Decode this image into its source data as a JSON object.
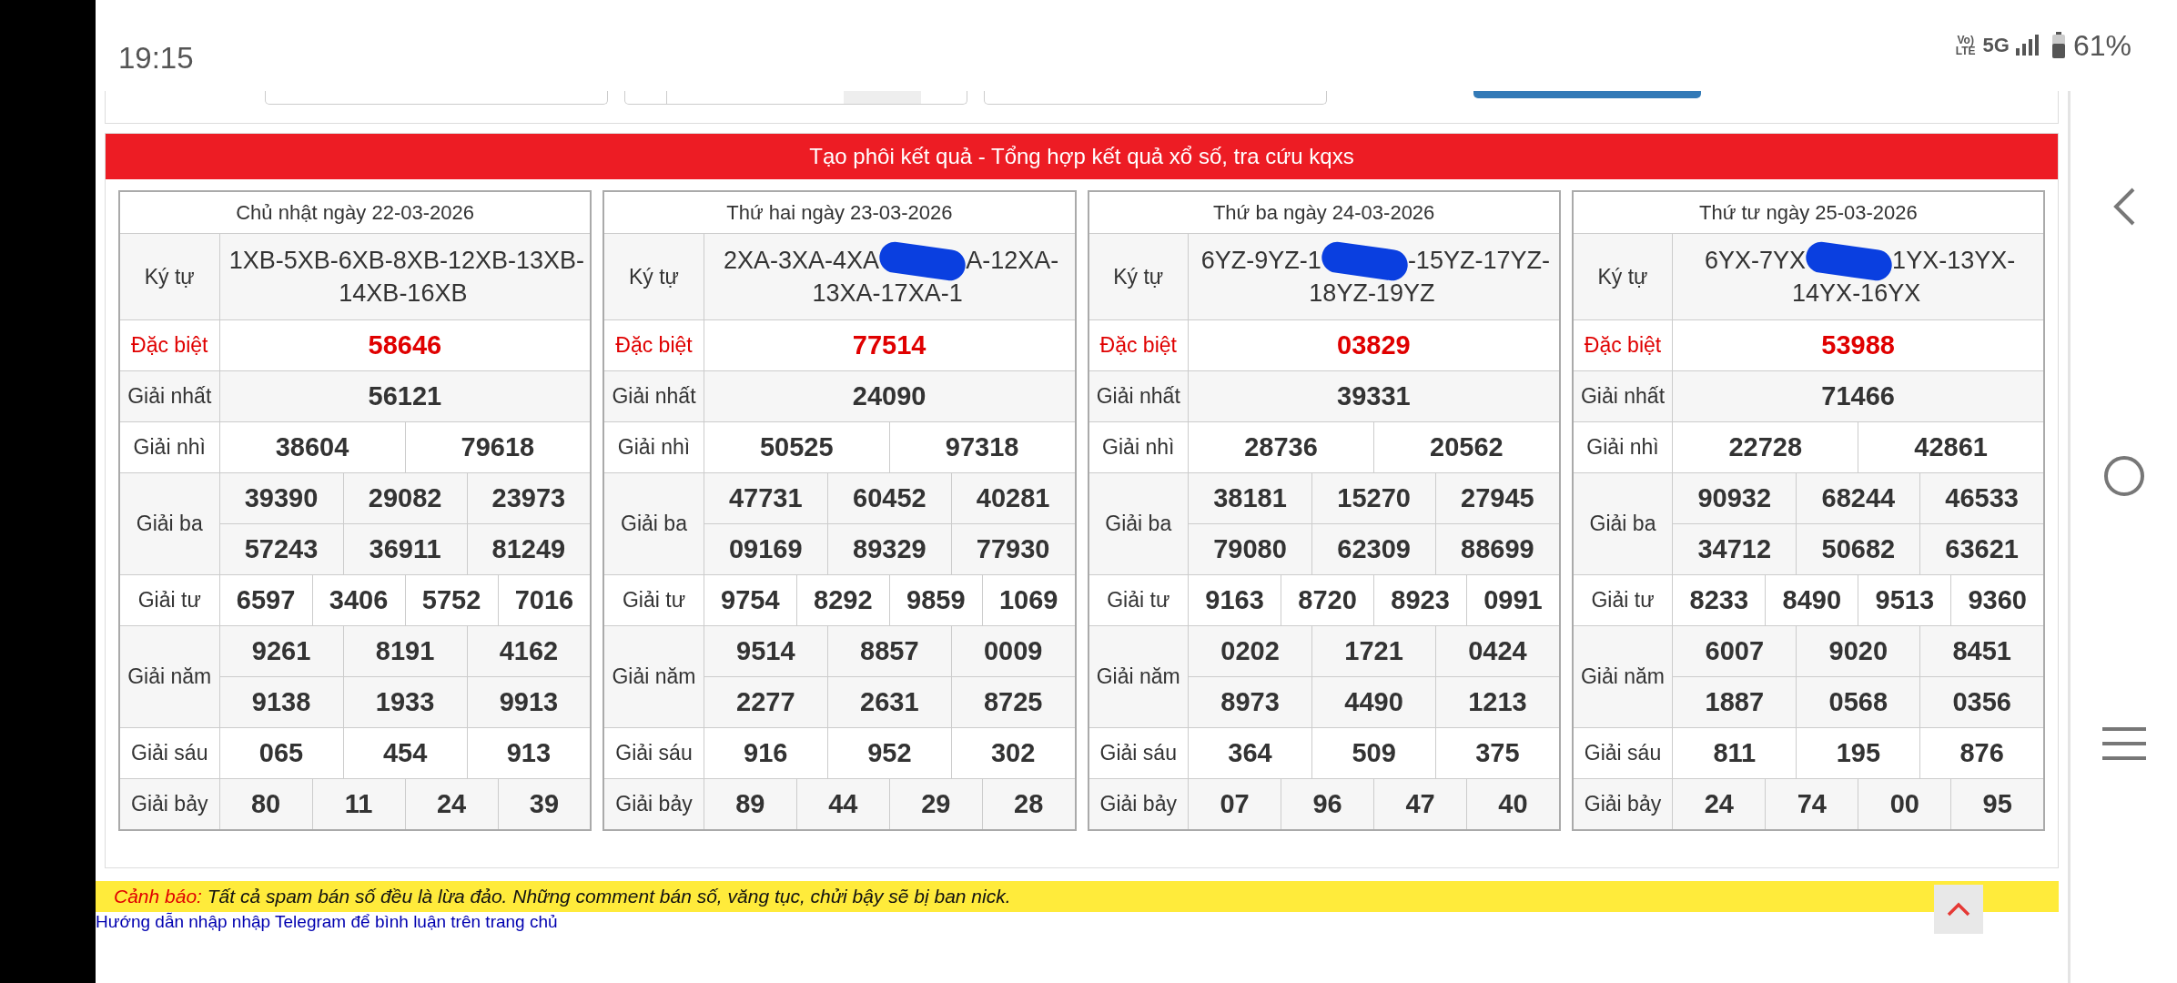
{
  "status_bar": {
    "time": "19:15",
    "volte": [
      "Vo)",
      "LTE"
    ],
    "network": "5G",
    "battery": "61%"
  },
  "banner": "Tạo phôi kết quả - Tổng hợp kết quả xổ số, tra cứu kqxs",
  "results": [
    {
      "date": "Chủ nhật ngày 22-03-2026",
      "ky_tu_label": "Ký tự",
      "ky_tu": [
        "1XB-5XB-6XB-8XB-12XB-13XB-14XB-16XB"
      ],
      "prizes": [
        {
          "label": "Đặc biệt",
          "kind": "special",
          "rows": [
            [
              "58646"
            ]
          ]
        },
        {
          "label": "Giải nhất",
          "kind": "normal",
          "rows": [
            [
              "56121"
            ]
          ]
        },
        {
          "label": "Giải nhì",
          "kind": "normal",
          "rows": [
            [
              "38604",
              "79618"
            ]
          ]
        },
        {
          "label": "Giải ba",
          "kind": "normal",
          "rows": [
            [
              "39390",
              "29082",
              "23973"
            ],
            [
              "57243",
              "36911",
              "81249"
            ]
          ]
        },
        {
          "label": "Giải tư",
          "kind": "normal",
          "rows": [
            [
              "6597",
              "3406",
              "5752",
              "7016"
            ]
          ]
        },
        {
          "label": "Giải năm",
          "kind": "normal",
          "rows": [
            [
              "9261",
              "8191",
              "4162"
            ],
            [
              "9138",
              "1933",
              "9913"
            ]
          ]
        },
        {
          "label": "Giải sáu",
          "kind": "normal",
          "rows": [
            [
              "065",
              "454",
              "913"
            ]
          ]
        },
        {
          "label": "Giải bảy",
          "kind": "normal",
          "rows": [
            [
              "80",
              "11",
              "24",
              "39"
            ]
          ]
        }
      ]
    },
    {
      "date": "Thứ hai ngày 23-03-2026",
      "ky_tu_label": "Ký tự",
      "ky_tu": [
        "2XA-3XA-4XA",
        "A-12XA-13XA-17XA-1"
      ],
      "prizes": [
        {
          "label": "Đặc biệt",
          "kind": "special",
          "rows": [
            [
              "77514"
            ]
          ]
        },
        {
          "label": "Giải nhất",
          "kind": "normal",
          "rows": [
            [
              "24090"
            ]
          ]
        },
        {
          "label": "Giải nhì",
          "kind": "normal",
          "rows": [
            [
              "50525",
              "97318"
            ]
          ]
        },
        {
          "label": "Giải ba",
          "kind": "normal",
          "rows": [
            [
              "47731",
              "60452",
              "40281"
            ],
            [
              "09169",
              "89329",
              "77930"
            ]
          ]
        },
        {
          "label": "Giải tư",
          "kind": "normal",
          "rows": [
            [
              "9754",
              "8292",
              "9859",
              "1069"
            ]
          ]
        },
        {
          "label": "Giải năm",
          "kind": "normal",
          "rows": [
            [
              "9514",
              "8857",
              "0009"
            ],
            [
              "2277",
              "2631",
              "8725"
            ]
          ]
        },
        {
          "label": "Giải sáu",
          "kind": "normal",
          "rows": [
            [
              "916",
              "952",
              "302"
            ]
          ]
        },
        {
          "label": "Giải bảy",
          "kind": "normal",
          "rows": [
            [
              "89",
              "44",
              "29",
              "28"
            ]
          ]
        }
      ]
    },
    {
      "date": "Thứ ba ngày 24-03-2026",
      "ky_tu_label": "Ký tự",
      "ky_tu": [
        "6YZ-9YZ-1",
        "-15YZ-17YZ-18YZ-19YZ"
      ],
      "prizes": [
        {
          "label": "Đặc biệt",
          "kind": "special",
          "rows": [
            [
              "03829"
            ]
          ]
        },
        {
          "label": "Giải nhất",
          "kind": "normal",
          "rows": [
            [
              "39331"
            ]
          ]
        },
        {
          "label": "Giải nhì",
          "kind": "normal",
          "rows": [
            [
              "28736",
              "20562"
            ]
          ]
        },
        {
          "label": "Giải ba",
          "kind": "normal",
          "rows": [
            [
              "38181",
              "15270",
              "27945"
            ],
            [
              "79080",
              "62309",
              "88699"
            ]
          ]
        },
        {
          "label": "Giải tư",
          "kind": "normal",
          "rows": [
            [
              "9163",
              "8720",
              "8923",
              "0991"
            ]
          ]
        },
        {
          "label": "Giải năm",
          "kind": "normal",
          "rows": [
            [
              "0202",
              "1721",
              "0424"
            ],
            [
              "8973",
              "4490",
              "1213"
            ]
          ]
        },
        {
          "label": "Giải sáu",
          "kind": "normal",
          "rows": [
            [
              "364",
              "509",
              "375"
            ]
          ]
        },
        {
          "label": "Giải bảy",
          "kind": "normal",
          "rows": [
            [
              "07",
              "96",
              "47",
              "40"
            ]
          ]
        }
      ]
    },
    {
      "date": "Thứ tư ngày 25-03-2026",
      "ky_tu_label": "Ký tự",
      "ky_tu": [
        "6YX-7YX",
        "1YX-13YX-14YX-16YX"
      ],
      "prizes": [
        {
          "label": "Đặc biệt",
          "kind": "special",
          "rows": [
            [
              "53988"
            ]
          ]
        },
        {
          "label": "Giải nhất",
          "kind": "normal",
          "rows": [
            [
              "71466"
            ]
          ]
        },
        {
          "label": "Giải nhì",
          "kind": "normal",
          "rows": [
            [
              "22728",
              "42861"
            ]
          ]
        },
        {
          "label": "Giải ba",
          "kind": "normal",
          "rows": [
            [
              "90932",
              "68244",
              "46533"
            ],
            [
              "34712",
              "50682",
              "63621"
            ]
          ]
        },
        {
          "label": "Giải tư",
          "kind": "normal",
          "rows": [
            [
              "8233",
              "8490",
              "9513",
              "9360"
            ]
          ]
        },
        {
          "label": "Giải năm",
          "kind": "normal",
          "rows": [
            [
              "6007",
              "9020",
              "8451"
            ],
            [
              "1887",
              "0568",
              "0356"
            ]
          ]
        },
        {
          "label": "Giải sáu",
          "kind": "normal",
          "rows": [
            [
              "811",
              "195",
              "876"
            ]
          ]
        },
        {
          "label": "Giải bảy",
          "kind": "normal",
          "rows": [
            [
              "24",
              "74",
              "00",
              "95"
            ]
          ]
        }
      ]
    }
  ],
  "warning": {
    "label": "Cảnh báo:",
    "text": "Tất cả spam bán số đều là lừa đảo. Những comment bán số, văng tục, chửi bậy sẽ bị ban nick."
  },
  "help_link": "Hướng dẫn nhập nhập Telegram để bình luận trên trang chủ"
}
